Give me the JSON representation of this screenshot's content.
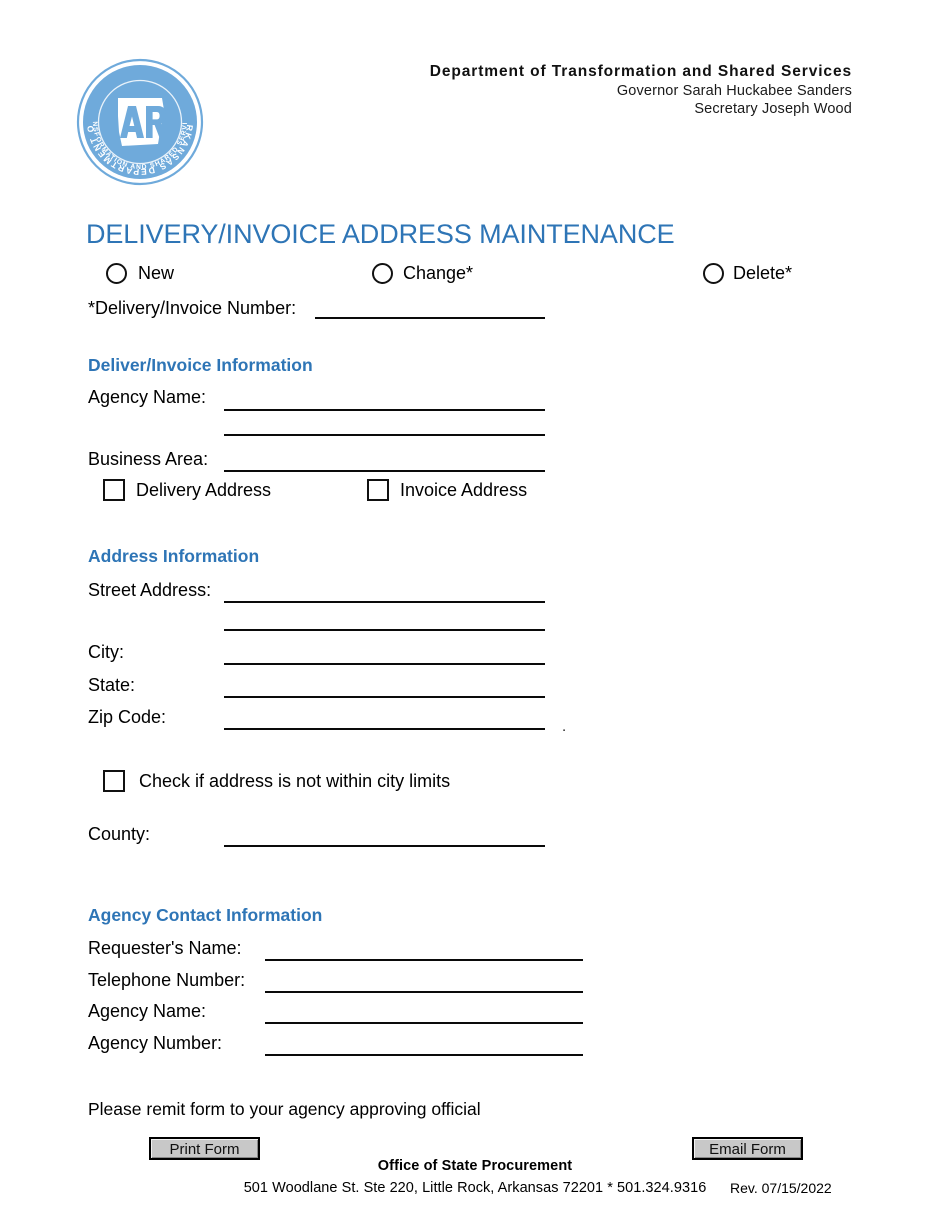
{
  "header": {
    "logo": {
      "icon": "arkansas-state-seal-logo",
      "arc_top_text": "ARKANSAS DEPARTMENT OF",
      "arc_bottom_text": "TRANSFORMATION AND SHARED SERVICES",
      "center_text": "AR",
      "color": "#6FAADB"
    },
    "department": "Department of Transformation and Shared Services",
    "governor": "Governor Sarah Huckabee Sanders",
    "secretary": "Secretary Joseph Wood"
  },
  "title": "DELIVERY/INVOICE ADDRESS MAINTENANCE",
  "title_color": "#2E75B6",
  "action_options": [
    {
      "label": "New"
    },
    {
      "label": "Change*"
    },
    {
      "label": "Delete*"
    }
  ],
  "delivery_number": {
    "label": "*Delivery/Invoice Number:",
    "value": ""
  },
  "sections": {
    "deliver_invoice": {
      "heading": "Deliver/Invoice Information",
      "agency_name_label": "Agency Name:",
      "agency_name_value": "",
      "agency_name_value_2": "",
      "business_area_label": "Business Area:",
      "business_area_value": "",
      "checkboxes": [
        {
          "label": "Delivery Address",
          "checked": false
        },
        {
          "label": "Invoice Address",
          "checked": false
        }
      ]
    },
    "address": {
      "heading": "Address Information",
      "street_label": "Street Address:",
      "street_value": "",
      "street_value_2": "",
      "city_label": "City:",
      "city_value": "",
      "state_label": "State:",
      "state_value": "",
      "zip_label": "Zip Code:",
      "zip_value": "",
      "zip_trailing_mark": ".",
      "city_limits_checkbox": {
        "label": "Check if address is not within city limits",
        "checked": false
      },
      "county_label": "County:",
      "county_value": ""
    },
    "agency_contact": {
      "heading": "Agency Contact Information",
      "fields": [
        {
          "label": "Requester's Name:",
          "value": ""
        },
        {
          "label": "Telephone Number:",
          "value": ""
        },
        {
          "label": "Agency Name:",
          "value": ""
        },
        {
          "label": "Agency Number:",
          "value": ""
        }
      ]
    }
  },
  "footer": {
    "remit_note": "Please remit form to your agency approving official",
    "print_button": "Print Form",
    "email_button": "Email Form",
    "organization": "Office of State Procurement",
    "address": "501 Woodlane St. Ste 220, Little Rock, Arkansas 72201 * 501.324.9316",
    "revision": "Rev. 07/15/2022"
  }
}
